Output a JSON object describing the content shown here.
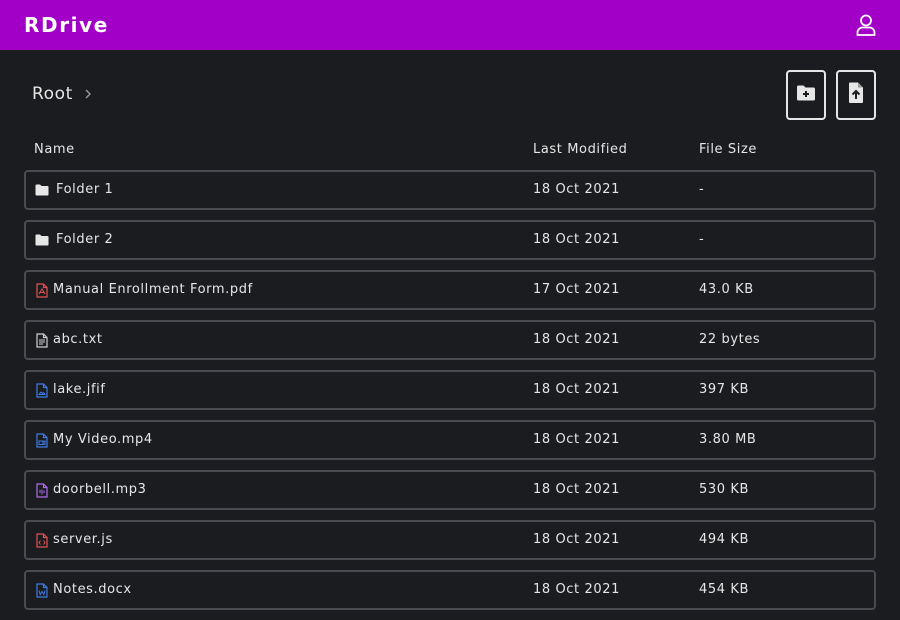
{
  "app": {
    "brand": "RDrive"
  },
  "breadcrumb": {
    "root": "Root"
  },
  "table": {
    "headers": {
      "name": "Name",
      "modified": "Last Modified",
      "size": "File Size"
    },
    "rows": [
      {
        "name": "Folder 1",
        "modified": "18 Oct 2021",
        "size": "-",
        "kind": "folder",
        "icon": "folder-icon",
        "color": "#e6e6e6"
      },
      {
        "name": "Folder 2",
        "modified": "18 Oct 2021",
        "size": "-",
        "kind": "folder",
        "icon": "folder-icon",
        "color": "#e6e6e6"
      },
      {
        "name": "Manual Enrollment Form.pdf",
        "modified": "17 Oct 2021",
        "size": "43.0 KB",
        "kind": "file",
        "icon": "pdf-file-icon",
        "color": "#e05252"
      },
      {
        "name": "abc.txt",
        "modified": "18 Oct 2021",
        "size": "22 bytes",
        "kind": "file",
        "icon": "text-file-icon",
        "color": "#cfcfcf"
      },
      {
        "name": "lake.jfif",
        "modified": "18 Oct 2021",
        "size": "397 KB",
        "kind": "file",
        "icon": "image-file-icon",
        "color": "#3d7be6"
      },
      {
        "name": "My Video.mp4",
        "modified": "18 Oct 2021",
        "size": "3.80 MB",
        "kind": "file",
        "icon": "video-file-icon",
        "color": "#3d7be6"
      },
      {
        "name": "doorbell.mp3",
        "modified": "18 Oct 2021",
        "size": "530 KB",
        "kind": "file",
        "icon": "audio-file-icon",
        "color": "#b06cf0"
      },
      {
        "name": "server.js",
        "modified": "18 Oct 2021",
        "size": "494 KB",
        "kind": "file",
        "icon": "code-file-icon",
        "color": "#e05252"
      },
      {
        "name": "Notes.docx",
        "modified": "18 Oct 2021",
        "size": "454 KB",
        "kind": "file",
        "icon": "word-file-icon",
        "color": "#3d7be6"
      }
    ]
  },
  "colors": {
    "accent": "#a200c6",
    "background": "#1b1c20",
    "row_border": "#4a4b50",
    "text": "#e6e6e6"
  }
}
